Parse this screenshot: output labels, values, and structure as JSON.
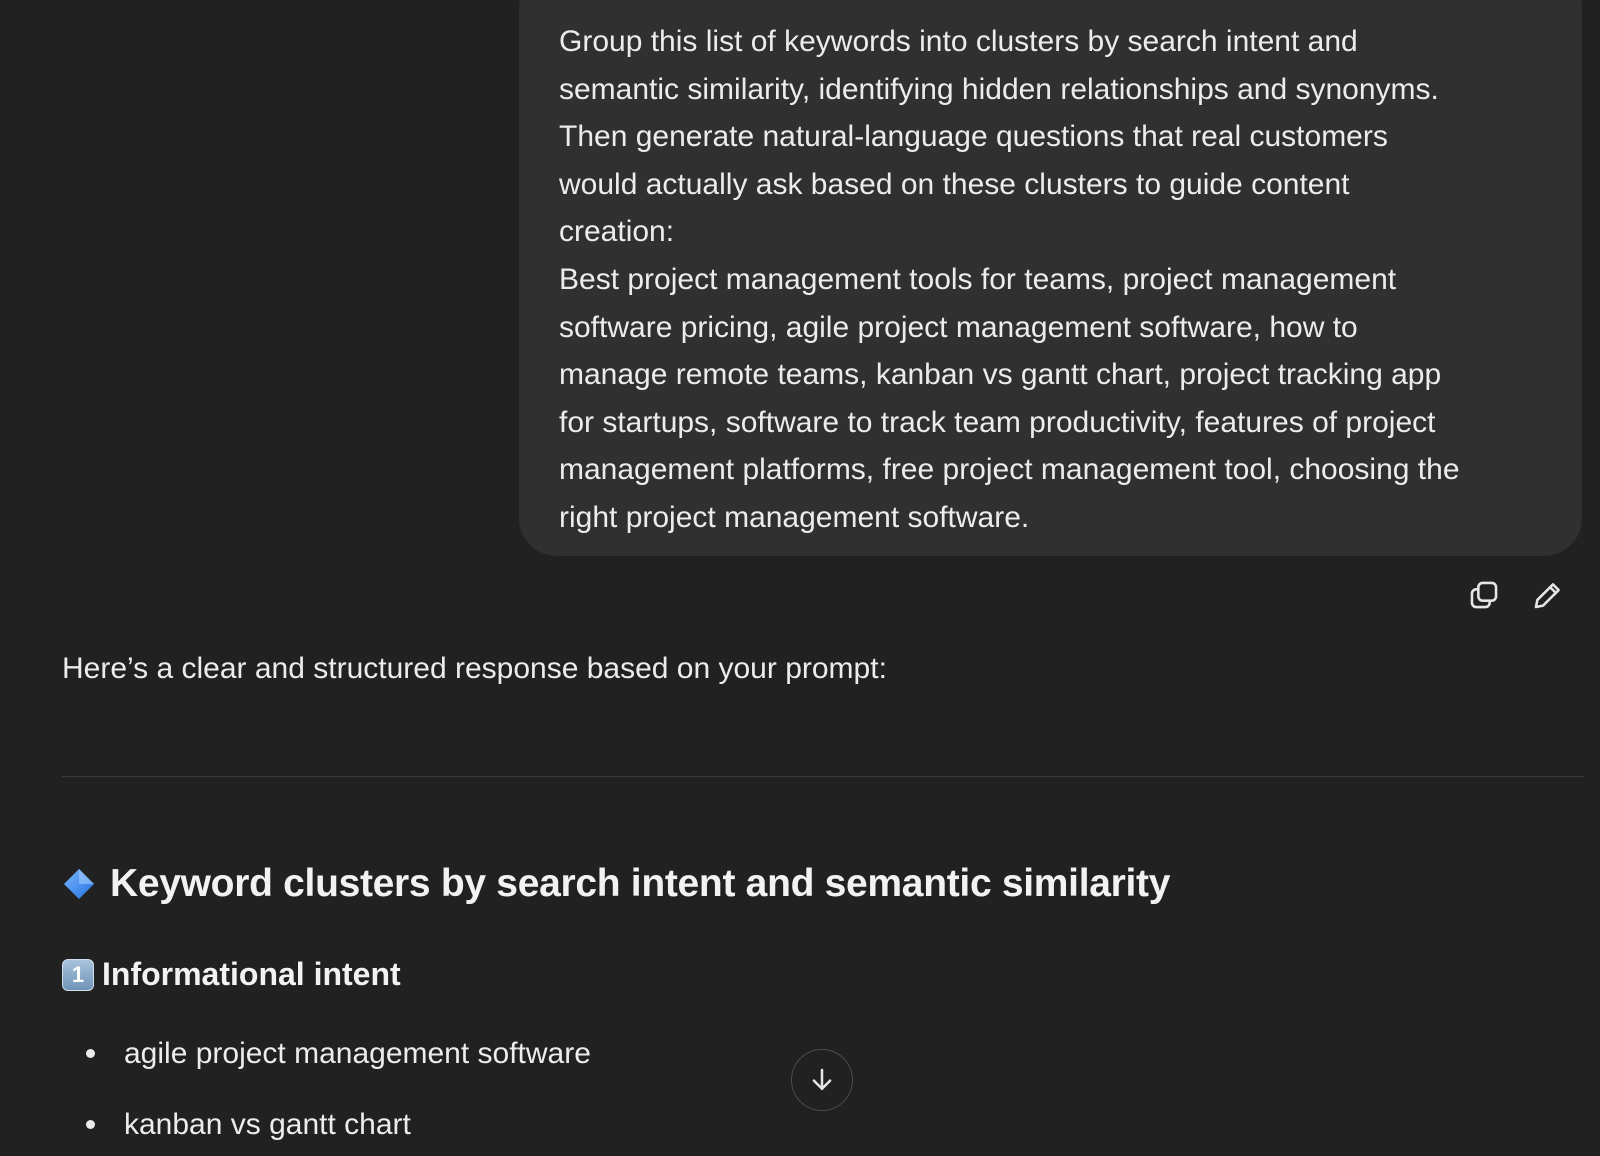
{
  "user_message": {
    "lines": [
      "Group this list of keywords into clusters by search intent and",
      "semantic similarity, identifying hidden relationships and synonyms.",
      "Then generate natural-language questions that real customers",
      "would actually ask based on these clusters to guide content",
      "creation:",
      "Best project management tools for teams, project management",
      "software pricing, agile project management software, how to",
      "manage remote teams, kanban vs gantt chart, project tracking app",
      "for startups, software to track team productivity, features of project",
      "management platforms, free project management tool, choosing the",
      "right project management software."
    ],
    "actions": [
      {
        "name": "copy-button",
        "icon": "copy-icon"
      },
      {
        "name": "edit-button",
        "icon": "pencil-icon"
      }
    ]
  },
  "assistant": {
    "intro": "Here’s a clear and structured response based on your prompt:",
    "heading": {
      "icon": "blue-diamond-icon",
      "text": "Keyword clusters by search intent and semantic similarity"
    },
    "section": {
      "icon": "keycap-1-icon",
      "icon_text": "1",
      "text": "Informational intent",
      "items": [
        "agile project management software",
        "kanban vs gantt chart"
      ]
    }
  },
  "scroll_button": {
    "icon": "arrow-down-icon"
  },
  "colors": {
    "background": "#212121",
    "bubble": "#303030",
    "text": "#ececec",
    "diamond": "#3d8bfd"
  }
}
